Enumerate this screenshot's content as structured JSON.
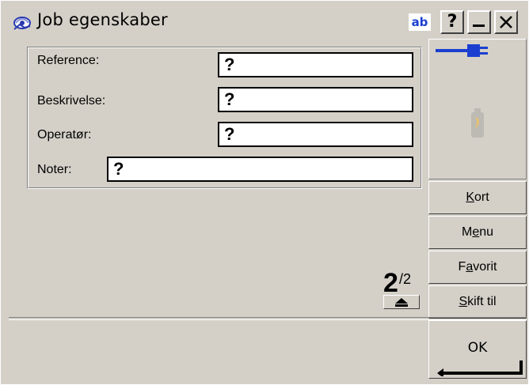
{
  "window": {
    "title": "Job egenskaber",
    "input_mode": "ab",
    "help_label": "?",
    "minimize_label": "—",
    "close_label": "X"
  },
  "form": {
    "fields": [
      {
        "label": "Reference:",
        "value": "?"
      },
      {
        "label": "Beskrivelse:",
        "value": "?"
      },
      {
        "label": "Operatør:",
        "value": "?"
      },
      {
        "label": "Noter:",
        "value": "?"
      }
    ]
  },
  "side_buttons": [
    {
      "pre": "",
      "key": "K",
      "post": "ort"
    },
    {
      "pre": "M",
      "key": "e",
      "post": "nu"
    },
    {
      "pre": "F",
      "key": "a",
      "post": "vorit"
    },
    {
      "pre": "",
      "key": "S",
      "post": "kift til"
    }
  ],
  "page": {
    "current": "2",
    "total": "/2"
  },
  "ok": {
    "label": "OK"
  },
  "icons": {
    "app": "receiver-icon",
    "status_power": "power-plug-icon",
    "status_battery": "battery-icon",
    "enter": "enter-key-icon"
  },
  "colors": {
    "accent": "#1a3fd0",
    "face": "#d4d0c8"
  }
}
